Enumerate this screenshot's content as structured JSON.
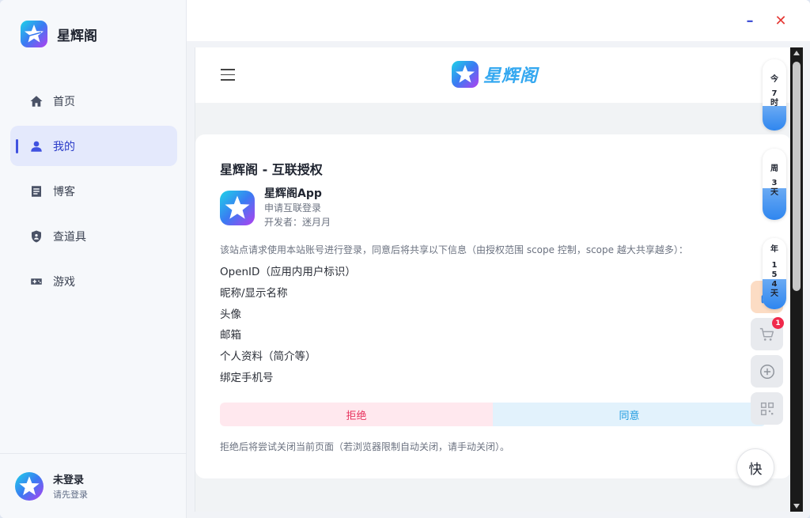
{
  "app": {
    "name": "星辉阁"
  },
  "colors": {
    "accent": "#4052e0",
    "reject": "#e8345f",
    "accept": "#1e9be0",
    "badge": "#f0294b"
  },
  "sidebar": {
    "items": [
      {
        "label": "首页",
        "icon": "home-icon",
        "active": false
      },
      {
        "label": "我的",
        "icon": "user-icon",
        "active": true
      },
      {
        "label": "博客",
        "icon": "document-icon",
        "active": false
      },
      {
        "label": "查道具",
        "icon": "shield-icon",
        "active": false
      },
      {
        "label": "游戏",
        "icon": "gamepad-icon",
        "active": false
      }
    ]
  },
  "user": {
    "name": "未登录",
    "hint": "请先登录"
  },
  "window_controls": {
    "minimize": "–",
    "close": "✕"
  },
  "web": {
    "logo_text": "星辉阁",
    "card": {
      "title": "星辉阁 - 互联授权",
      "app_name": "星辉阁App",
      "app_action": "申请互联登录",
      "developer": "开发者：迷月月",
      "description": "该站点请求使用本站账号进行登录，同意后将共享以下信息（由授权范围 scope 控制，scope 越大共享越多）：",
      "scopes": [
        "OpenID（应用内用户标识）",
        "昵称/显示名称",
        "头像",
        "邮箱",
        "个人资料（简介等）",
        "绑定手机号"
      ],
      "reject_label": "拒绝",
      "accept_label": "同意",
      "note": "拒绝后将尝试关闭当前页面（若浏览器限制自动关闭，请手动关闭）。"
    }
  },
  "widgets": {
    "progress": [
      {
        "chars": [
          "今",
          "7",
          "时"
        ],
        "fill": 0.35
      },
      {
        "chars": [
          "周",
          "3",
          "天"
        ],
        "fill": 0.45
      },
      {
        "chars": [
          "年",
          "1",
          "5",
          "4",
          "天"
        ],
        "fill": 0.42
      }
    ],
    "cart_badge": "1",
    "fast_label": "快"
  }
}
